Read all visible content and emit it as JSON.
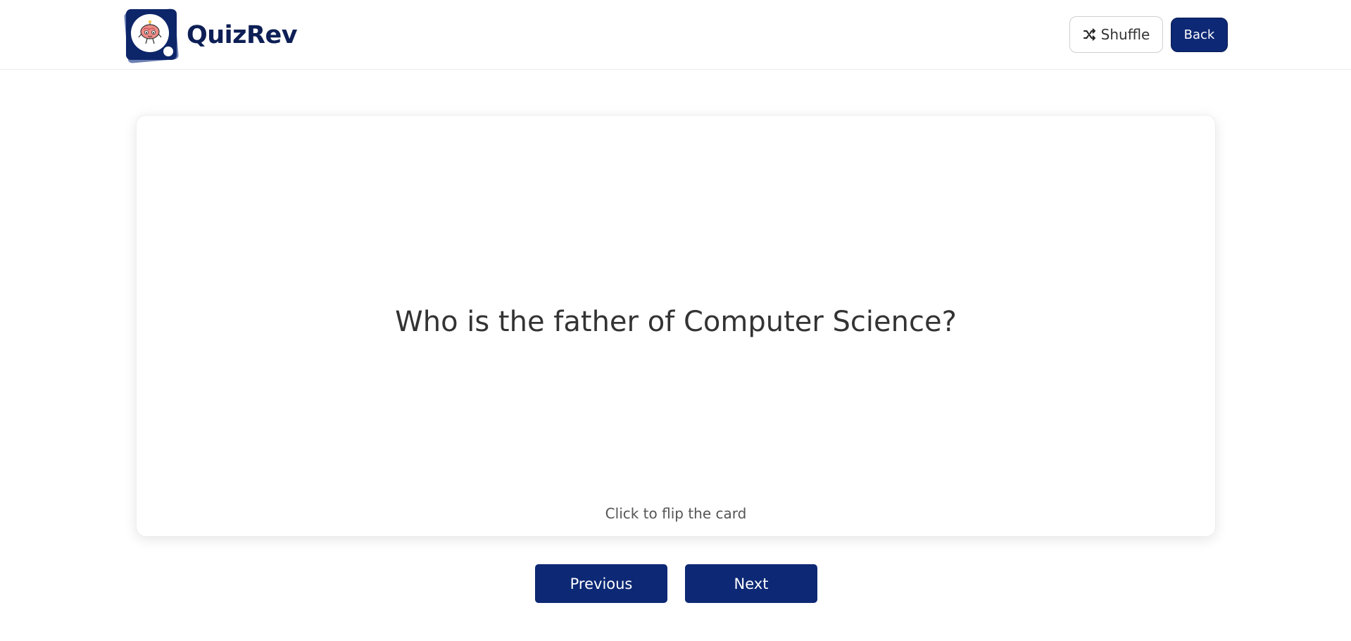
{
  "header": {
    "brand_name": "QuizRev",
    "shuffle_label": "Shuffle",
    "back_label": "Back"
  },
  "card": {
    "question": "Who is the father of Computer Science?",
    "hint": "Click to flip the card"
  },
  "navigation": {
    "previous_label": "Previous",
    "next_label": "Next"
  },
  "colors": {
    "primary": "#0d2874",
    "brand_text": "#0d1f55",
    "logo_bg": "#0d2669"
  },
  "icons": {
    "logo": "brain-mascot-icon",
    "shuffle": "shuffle-icon"
  }
}
